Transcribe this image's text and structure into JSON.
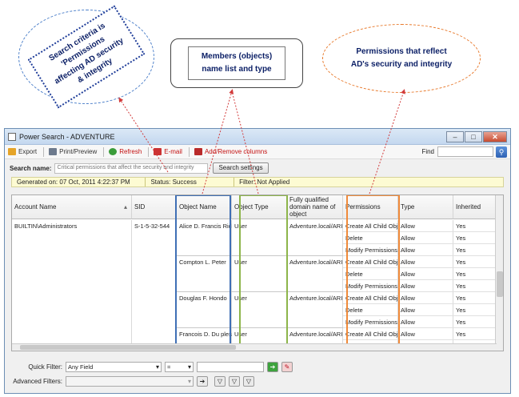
{
  "callouts": {
    "search_criteria": "Search criteria is 'Permissions affecting AD security & integrity",
    "members_line1": "Members (objects)",
    "members_line2": "name list and type",
    "permissions": "Permissions that reflect AD's security and integrity"
  },
  "window": {
    "title": "Power Search - ADVENTURE",
    "buttons": {
      "minimize": "–",
      "maximize": "□",
      "close": "✕"
    }
  },
  "toolbar": {
    "export": "Export",
    "print_preview": "Print/Preview",
    "refresh": "Refresh",
    "email": "E-mail",
    "add_remove_columns": "Add/Remove columns",
    "find_label": "Find"
  },
  "search": {
    "label": "Search name:",
    "value": "Critical permissions that affect the security and integrity",
    "settings_button": "Search settings"
  },
  "status": {
    "generated": "Generated on: 07 Oct, 2011 4:22:37 PM",
    "status": "Status: Success",
    "filter": "Filter: Not Applied"
  },
  "grid": {
    "columns": [
      "Account Name",
      "SID",
      "Object Name",
      "Object Type",
      "Fully qualified domain name of object",
      "Permissions",
      "Type",
      "Inherited"
    ],
    "account": {
      "name": "BUILTIN\\Administrators",
      "sid": "S-1-5-32-544"
    },
    "objects": [
      {
        "name": "Alice D. Francis Rich",
        "type": "User",
        "fqdn": "Adventure.local/ARI"
      },
      {
        "name": "Compton L. Peter",
        "type": "User",
        "fqdn": "Adventure.local/ARI"
      },
      {
        "name": "Douglas F. Hondo",
        "type": "User",
        "fqdn": "Adventure.local/ARI"
      },
      {
        "name": "Francois D. Du plessi",
        "type": "User",
        "fqdn": "Adventure.local/ARI"
      }
    ],
    "rows": [
      {
        "perm": "Create All Child Obj",
        "type": "Allow",
        "inh": "Yes"
      },
      {
        "perm": "Delete",
        "type": "Allow",
        "inh": "Yes"
      },
      {
        "perm": "Modify Permissions",
        "type": "Allow",
        "inh": "Yes"
      },
      {
        "perm": "Create All Child Obj",
        "type": "Allow",
        "inh": "Yes"
      },
      {
        "perm": "Delete",
        "type": "Allow",
        "inh": "Yes"
      },
      {
        "perm": "Modify Permissions",
        "type": "Allow",
        "inh": "Yes"
      },
      {
        "perm": "Create All Child Obj",
        "type": "Allow",
        "inh": "Yes"
      },
      {
        "perm": "Delete",
        "type": "Allow",
        "inh": "Yes"
      },
      {
        "perm": "Modify Permissions",
        "type": "Allow",
        "inh": "Yes"
      },
      {
        "perm": "Create All Child Obj",
        "type": "Allow",
        "inh": "Yes"
      }
    ]
  },
  "filters": {
    "quick_label": "Quick Filter:",
    "quick_field": "Any Field",
    "operator": "=",
    "advanced_label": "Advanced Filters:"
  },
  "colors": {
    "object_name_highlight": "#3f6fb5",
    "object_type_highlight": "#8db54a",
    "permissions_highlight": "#f08a3a",
    "arrow": "#d23b3b"
  }
}
